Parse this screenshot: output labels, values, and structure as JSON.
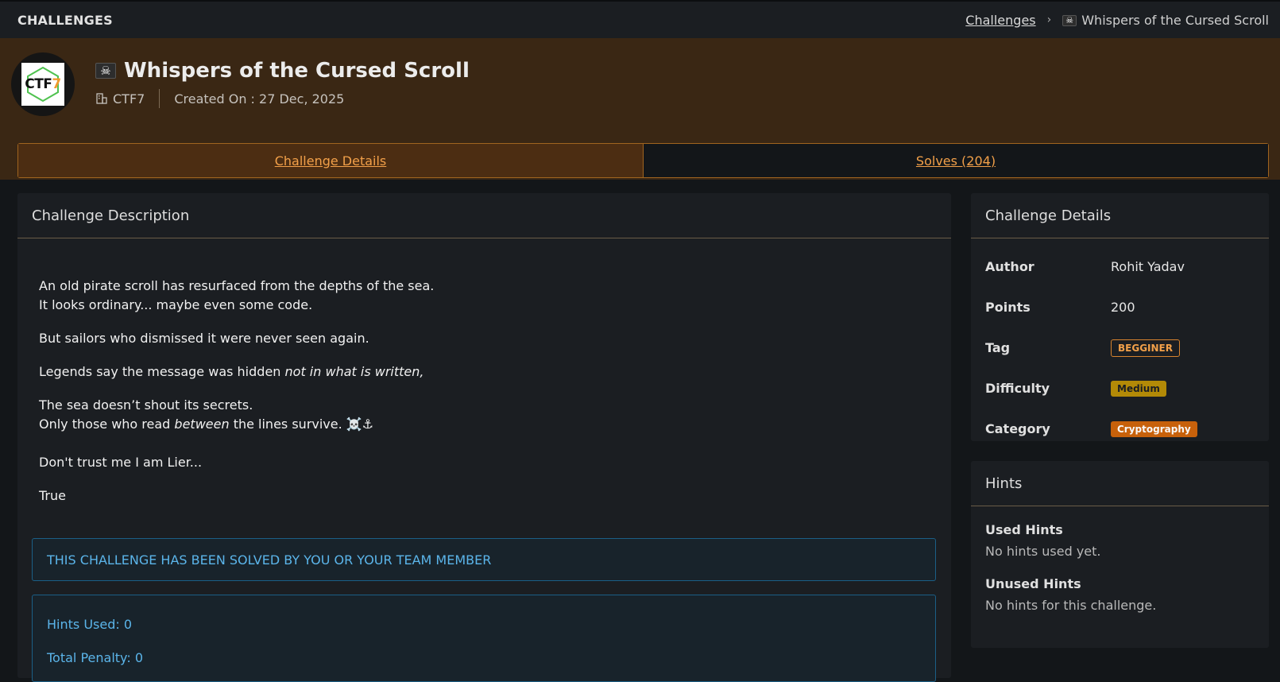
{
  "topbar": {
    "page_label": "CHALLENGES",
    "breadcrumb_link": "Challenges",
    "breadcrumb_current": "Whispers of the Cursed Scroll"
  },
  "hero": {
    "logo_text_a": "CTF",
    "logo_text_b": "7",
    "title": "Whispers of the Cursed Scroll",
    "org": "CTF7",
    "created": "Created On : 27 Dec, 2025"
  },
  "tabs": [
    {
      "label": "Challenge Details"
    },
    {
      "label": "Solves (204)"
    }
  ],
  "description": {
    "header": "Challenge Description",
    "line1": "An old pirate scroll has resurfaced from the depths of the sea.",
    "line2": "It looks ordinary... maybe even some code.",
    "line3": "But sailors who dismissed it were never seen again.",
    "line4_a": "Legends say the message was hidden ",
    "line4_b": "not in what is written,",
    "line5": "The sea doesn’t shout its secrets.",
    "line6_a": "Only those who read ",
    "line6_b": "between",
    "line6_c": " the lines survive. ☠️⚓",
    "line7": "Don't trust me I am Lier...",
    "line8": "True"
  },
  "alerts": {
    "solved": "THIS CHALLENGE HAS BEEN SOLVED BY YOU OR YOUR TEAM MEMBER",
    "hints_used": "Hints Used: 0",
    "penalty": "Total Penalty: 0"
  },
  "details": {
    "header": "Challenge Details",
    "author_k": "Author",
    "author_v": "Rohit Yadav",
    "points_k": "Points",
    "points_v": "200",
    "tag_k": "Tag",
    "tag_v": "BEGGINER",
    "difficulty_k": "Difficulty",
    "difficulty_v": "Medium",
    "category_k": "Category",
    "category_v": "Cryptography"
  },
  "hints": {
    "header": "Hints",
    "used_title": "Used Hints",
    "used_text": "No hints used yet.",
    "unused_title": "Unused Hints",
    "unused_text": "No hints for this challenge."
  },
  "colors": {
    "accent": "#f2a049",
    "hero_bg": "#3a2714",
    "info": "#5bb5ea",
    "medium": "#b38a07",
    "category": "#c7610b"
  },
  "icons": [
    "pirate-flag-icon",
    "building-icon",
    "chevron-right-icon"
  ]
}
